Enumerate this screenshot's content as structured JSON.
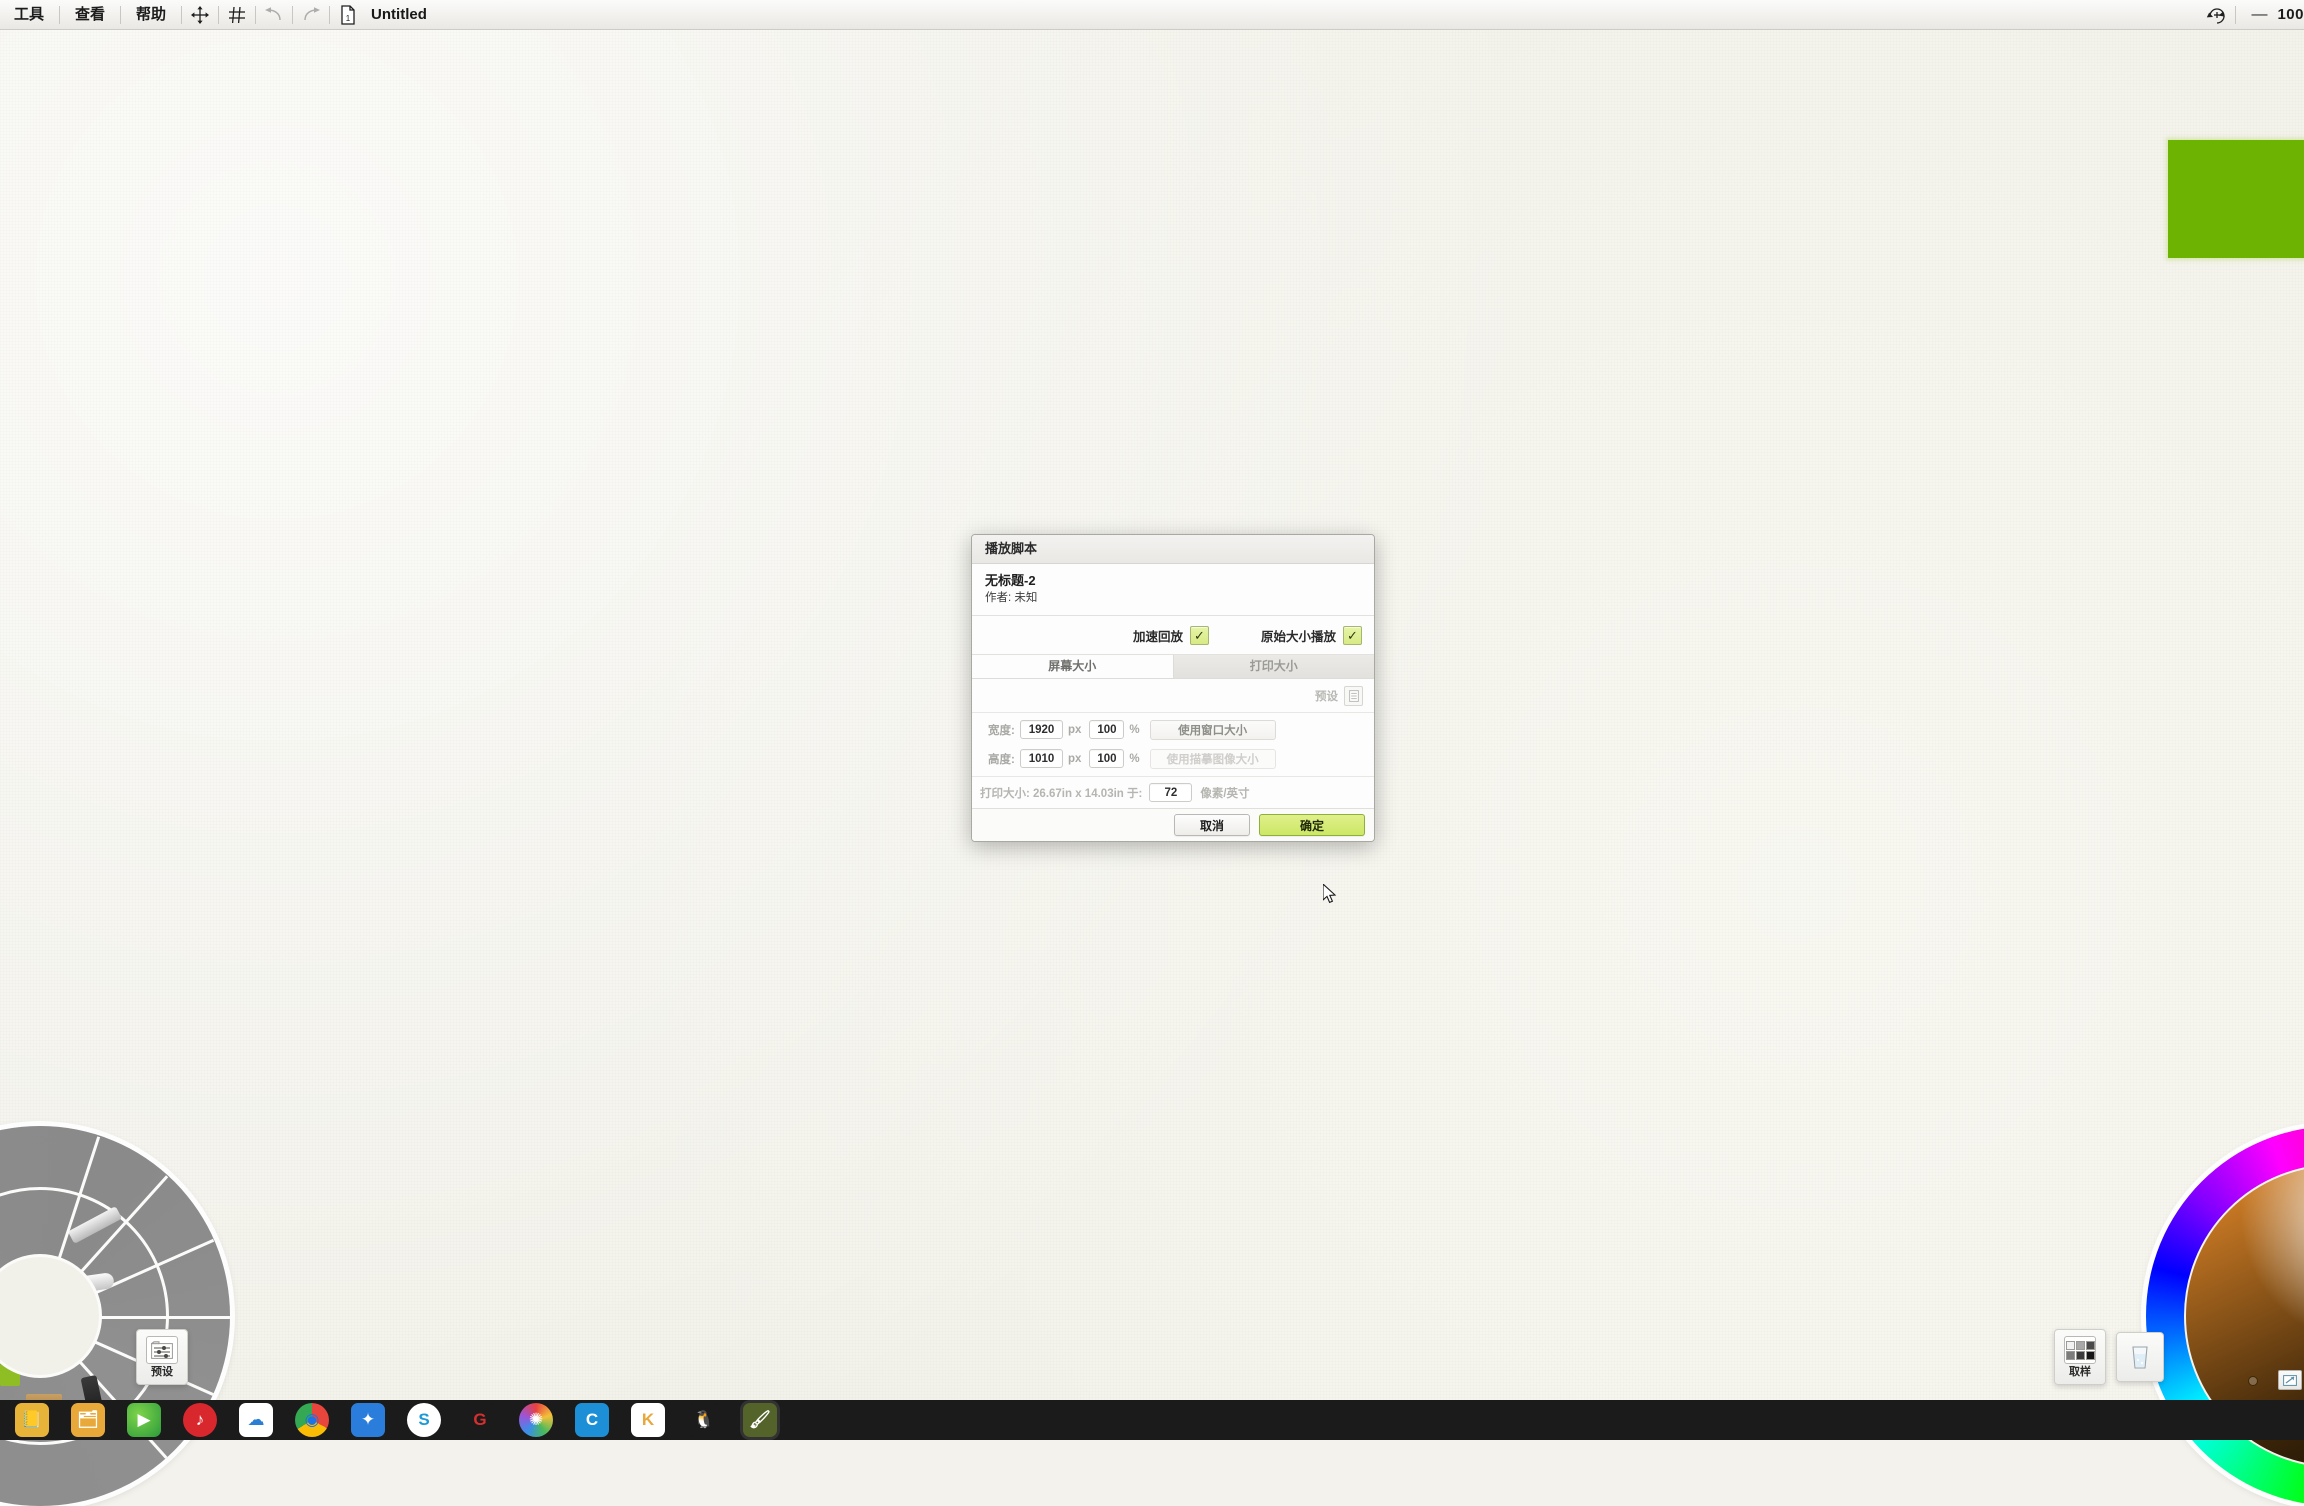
{
  "menubar": {
    "items": [
      {
        "label": "工具",
        "name": "menu-tools"
      },
      {
        "label": "查看",
        "name": "menu-view"
      },
      {
        "label": "帮助",
        "name": "menu-help"
      }
    ],
    "icons": [
      "move-icon",
      "grid-icon",
      "undo-icon",
      "redo-icon",
      "document-icon"
    ],
    "document_title": "Untitled",
    "right_icon": "rotate-canvas-icon",
    "minus_label": "—",
    "zoom_level": "100"
  },
  "canvas": {
    "stroke_color": "#6cb302"
  },
  "dialog": {
    "title": "播放脚本",
    "doc_name": "无标题-2",
    "doc_author": "作者: 未知",
    "options": [
      {
        "label": "加速回放",
        "checked": true,
        "mark": "✓"
      },
      {
        "label": "原始大小播放",
        "checked": true,
        "mark": "✓"
      }
    ],
    "tabs": [
      {
        "label": "屏幕大小",
        "active": true
      },
      {
        "label": "打印大小",
        "active": false
      }
    ],
    "preset_label": "预设",
    "preset_icon": "list-preset-icon",
    "width_row": {
      "label": "宽度:",
      "value": "1920",
      "unit": "px",
      "percent": "100",
      "percent_unit": "%",
      "button": "使用窗口大小"
    },
    "height_row": {
      "label": "高度:",
      "value": "1010",
      "unit": "px",
      "percent": "100",
      "percent_unit": "%",
      "button": "使用描摹图像大小"
    },
    "print_line": "打印大小: 26.67in x 14.03in 于:",
    "dpi_value": "72",
    "dpi_unit": "像素/英寸",
    "cancel_label": "取消",
    "ok_label": "确定",
    "ok_color": "#cde765"
  },
  "tool_picker": {
    "name": "radial-tool-picker"
  },
  "preset_panel": {
    "label": "预设",
    "icon": "sliders-icon"
  },
  "sample_panel": {
    "label": "取样",
    "icon": "swatch-grid-icon"
  },
  "water_panel": {
    "icon": "water-glass-icon"
  },
  "color_picker": {
    "name": "color-wheel"
  },
  "taskbar": {
    "icons": [
      {
        "name": "taskbar-icon-notes",
        "glyph": "📒",
        "color": "#e8b339"
      },
      {
        "name": "taskbar-icon-file-manager",
        "glyph": "🗂",
        "color": "#e8a83a"
      },
      {
        "name": "taskbar-icon-media-player",
        "glyph": "▶",
        "color": "#3bb54a"
      },
      {
        "name": "taskbar-icon-netease-music",
        "glyph": "♪",
        "color": "#d9272e"
      },
      {
        "name": "taskbar-icon-baidu-netdisk",
        "glyph": "☁",
        "color": "#2a7fd4"
      },
      {
        "name": "taskbar-icon-chrome",
        "glyph": "◉",
        "color": "#2e9a3a"
      },
      {
        "name": "taskbar-icon-foxmail",
        "glyph": "✦",
        "color": "#2b7ddb"
      },
      {
        "name": "taskbar-icon-sogou",
        "glyph": "S",
        "color": "#1c9ad6"
      },
      {
        "name": "taskbar-icon-browser",
        "glyph": "G",
        "color": "#d62f2f"
      },
      {
        "name": "taskbar-icon-color-app",
        "glyph": "✺",
        "color": "#d8c23a"
      },
      {
        "name": "taskbar-icon-cad",
        "glyph": "C",
        "color": "#1c8fd6"
      },
      {
        "name": "taskbar-icon-office",
        "glyph": "K",
        "color": "#e8a83a"
      },
      {
        "name": "taskbar-icon-qq",
        "glyph": "🐧",
        "color": "#222222"
      },
      {
        "name": "taskbar-icon-artrage",
        "glyph": "🖌",
        "color": "#54632a"
      }
    ]
  }
}
